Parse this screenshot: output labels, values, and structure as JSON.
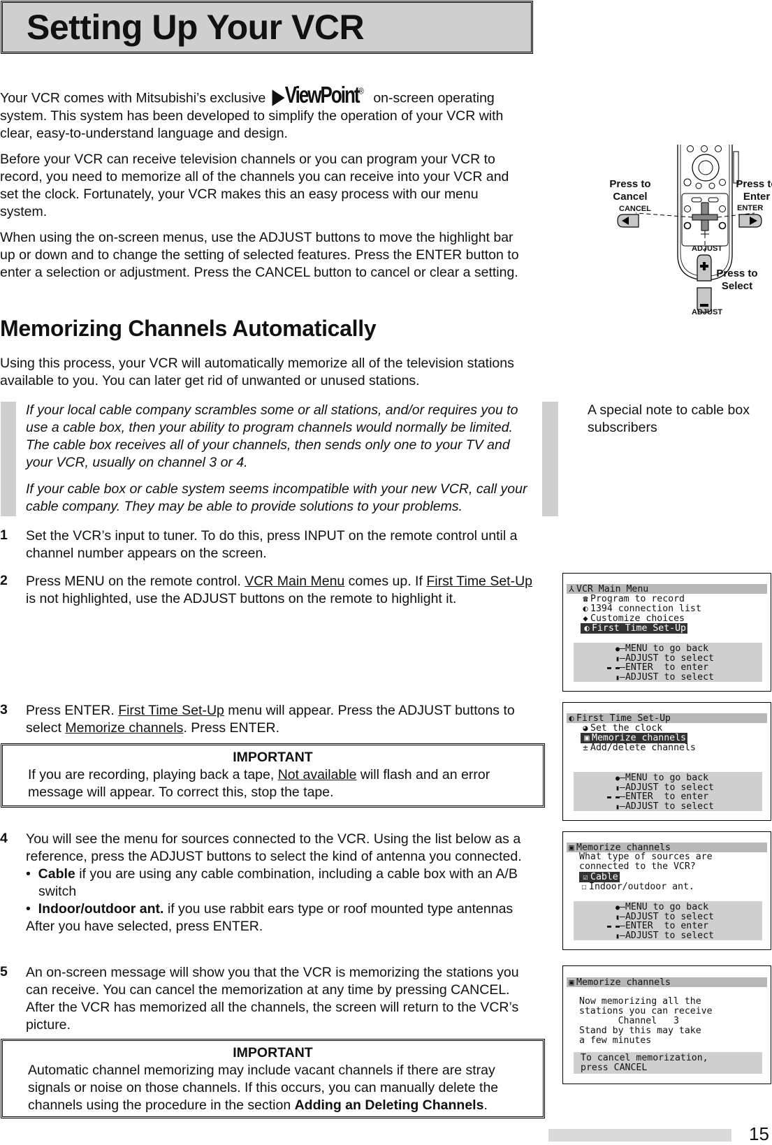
{
  "title": "Setting Up Your VCR",
  "intro": {
    "p1_before": "Your VCR comes with Mitsubishi’s exclusive",
    "logo_text": "ViewPoint",
    "logo_reg": "®",
    "p1_after": "on-screen operating system.  This system has been developed to simplify the operation of your VCR with clear, easy-to-understand language and design.",
    "p2": "Before your VCR can receive television channels or you can program your VCR to record, you need to memorize all of the channels you can receive into your VCR and set the clock.  Fortunately, your VCR makes this an easy process with our menu system.",
    "p3": "When using the on-screen menus, use the ADJUST buttons to move the highlight bar up or down and to change the setting of selected features.  Press the ENTER button to enter a selection or adjustment.  Press the CANCEL button to cancel or clear a setting."
  },
  "remote_diagram": {
    "press_cancel": "Press to\nCancel",
    "press_enter": "Press to\nEnter",
    "press_select": "Press to\nSelect",
    "cancel_label": "CANCEL",
    "enter_label": "ENTER",
    "adjust_top_label": "ADJUST",
    "adjust_bottom_label": "ADJUST"
  },
  "section": {
    "heading": "Memorizing Channels Automatically",
    "intro": "Using this process, your VCR will automatically memorize all of the television stations available to you.  You can later get rid of unwanted or unused stations."
  },
  "cable_note": {
    "p1": "If your local cable company scrambles some or all stations, and/or requires you to use a cable box, then your ability to program channels would normally be limited.  The cable box receives all of your channels, then sends only one to your TV and your VCR, usually on channel 3 or 4.",
    "p2": "If your cable box or cable system seems incompatible with your new VCR, call your cable company.  They may be able to provide solutions to your problems.",
    "side_label": "A special note to cable box subscribers"
  },
  "steps": [
    {
      "num": "1",
      "text": "Set the VCR’s input to tuner.  To do this, press INPUT on the remote control until a channel number appears on the screen."
    },
    {
      "num": "2",
      "t1": "Press MENU on the remote control.  ",
      "u1": "VCR Main Menu",
      "t2": " comes up.  If ",
      "u2": "First Time Set-Up",
      "t3": " is not highlighted, use the ADJUST buttons on the remote to highlight it."
    },
    {
      "num": "3",
      "t1": "Press ENTER.  ",
      "u1": "First Time Set-Up",
      "t2": " menu will appear.  Press the ADJUST buttons to select ",
      "u2": "Memorize channels",
      "t3": ".  Press ENTER."
    },
    {
      "num": "4",
      "text": "You will see the menu for sources connected to the VCR.  Using the list below as a reference, press the ADJUST buttons to select the kind of antenna you connected.",
      "bullets": [
        {
          "bold": "Cable",
          "text": " if you are using any cable combination, including a cable box with an A/B switch"
        },
        {
          "bold": "Indoor/outdoor ant.",
          "text": " if you use rabbit ears type or roof mounted type antennas"
        }
      ],
      "after": "After you have selected, press ENTER."
    },
    {
      "num": "5",
      "text": "An on-screen message will show you that the VCR is memorizing the stations you can receive.  You can cancel the memorization at any time by pressing CANCEL.  After the VCR has memorized all the channels, the screen will return to the VCR’s picture."
    }
  ],
  "important1": {
    "heading": "IMPORTANT",
    "t1": "If you are recording, playing back a tape, ",
    "u1": "Not available",
    "t2": " will flash and an error message will appear.  To correct this, stop the tape."
  },
  "important2": {
    "heading": "IMPORTANT",
    "t1": "Automatic channel memorizing may include vacant channels if there are stray signals or noise on those channels.  If this occurs, you can manually delete the channels using the procedure in the section ",
    "b1": "Adding an Deleting Channels",
    "t2": "."
  },
  "osd_help": {
    "menu": "MENU to go back",
    "adjust_up": "ADJUST to select",
    "enter": "ENTER  to enter",
    "adjust_down": "ADJUST to select"
  },
  "osd1": {
    "title": "VCR Main Menu",
    "items": [
      "Program to record",
      "1394 connection list",
      "Customize choices",
      "First Time Set-Up"
    ],
    "selected": "First Time Set-Up"
  },
  "osd2": {
    "title": "First Time Set-Up",
    "items": [
      "Set the clock",
      "Memorize channels",
      "Add/delete channels"
    ],
    "selected": "Memorize channels"
  },
  "osd3": {
    "title": "Memorize channels",
    "question1": "What type of sources are",
    "question2": "connected to the VCR?",
    "options": [
      {
        "label": "Cable",
        "checked": true
      },
      {
        "label": "Indoor/outdoor ant.",
        "checked": false
      }
    ]
  },
  "osd4": {
    "title": "Memorize channels",
    "lines": [
      "Now memorizing all the",
      "stations you can receive",
      "       Channel   3",
      "Stand by this may take",
      "a few minutes"
    ],
    "cancel1": "To cancel memorization,",
    "cancel2": "press CANCEL"
  },
  "page_number": "15"
}
